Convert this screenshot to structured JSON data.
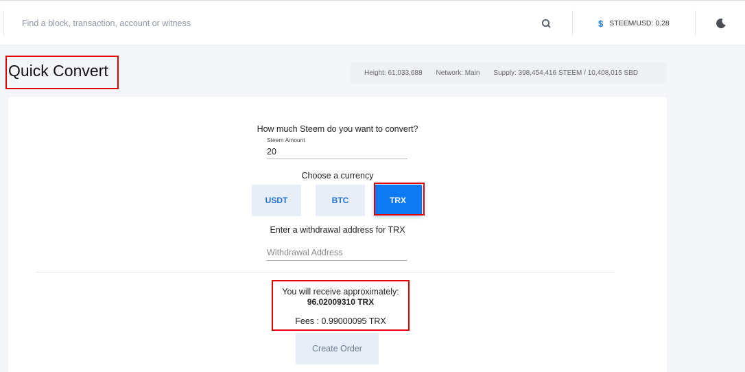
{
  "search": {
    "placeholder": "Find a block, transaction, account or witness"
  },
  "price": {
    "label": "STEEM/USD: 0.28",
    "icon": "dollar-icon"
  },
  "page": {
    "title": "Quick Convert"
  },
  "stats": {
    "height": "Height: 61,033,688",
    "network": "Network: Main",
    "supply": "Supply: 398,454,416 STEEM / 10,408,015 SBD"
  },
  "form": {
    "question": "How much Steem do you want to convert?",
    "amount_label": "Steem Amount",
    "amount_value": "20",
    "choose_label": "Choose a currency",
    "currencies": [
      "USDT",
      "BTC",
      "TRX"
    ],
    "selected_currency": "TRX",
    "address_label": "Enter a withdrawal address for TRX",
    "address_placeholder": "Withdrawal Address",
    "receive_label": "You will receive approximately:",
    "receive_amount": "96.02009310 TRX",
    "fees": "Fees : 0.99000095 TRX",
    "create_label": "Create Order"
  },
  "colors": {
    "accent": "#0d79f2",
    "highlight": "#e10000",
    "button_bg": "#e7eef8"
  }
}
